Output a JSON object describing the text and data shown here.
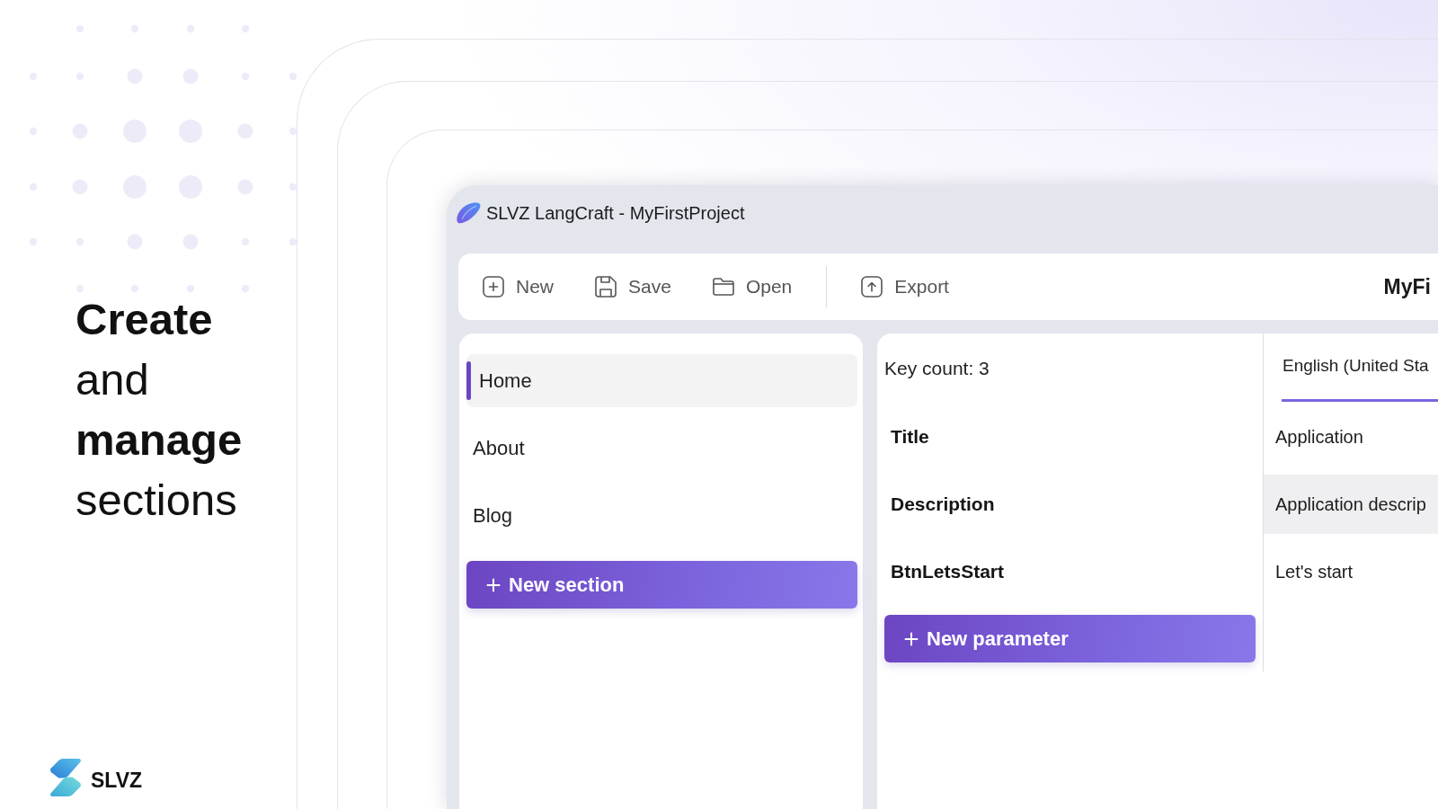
{
  "hero": {
    "headline": "**Create** and **manage** sections",
    "brand": "SLVZ"
  },
  "window": {
    "title": "SLVZ LangCraft - MyFirstProject"
  },
  "toolbar": {
    "groups": [
      {
        "buttons": [
          {
            "kind": "new",
            "label": "New"
          },
          {
            "kind": "save",
            "label": "Save"
          },
          {
            "kind": "open",
            "label": "Open"
          }
        ]
      },
      {
        "buttons": [
          {
            "kind": "export",
            "label": "Export"
          }
        ]
      }
    ],
    "project_name": "MyFi"
  },
  "sidebar": {
    "sections": [
      {
        "label": "Home",
        "selected": true
      },
      {
        "label": "About",
        "selected": false
      },
      {
        "label": "Blog",
        "selected": false
      }
    ],
    "add_button": {
      "label": "New section"
    }
  },
  "editor": {
    "key_count": "Key count: 3",
    "language_tabs": [
      {
        "label": "English (United Sta",
        "selected": true
      }
    ],
    "rows": [
      {
        "key": "Title",
        "value": "Application",
        "selected": false
      },
      {
        "key": "Description",
        "value": "Application descrip",
        "selected": true
      },
      {
        "key": "BtnLetsStart",
        "value": "Let's start",
        "selected": false
      }
    ],
    "add_button": {
      "label": "New parameter"
    }
  }
}
